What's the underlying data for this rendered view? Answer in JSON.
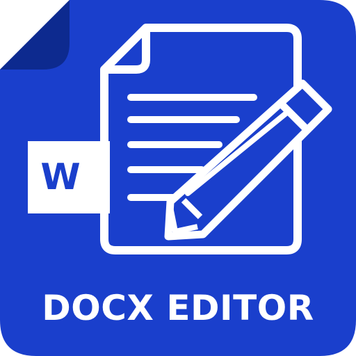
{
  "app": {
    "label": "DOCX EDITOR",
    "badge_letter": "W"
  },
  "colors": {
    "background": "#1a3fcc",
    "fold": "#0d2a8f",
    "foreground": "#ffffff"
  },
  "icons": {
    "main": "document-with-pencil-icon",
    "badge": "word-letter-badge-icon"
  }
}
